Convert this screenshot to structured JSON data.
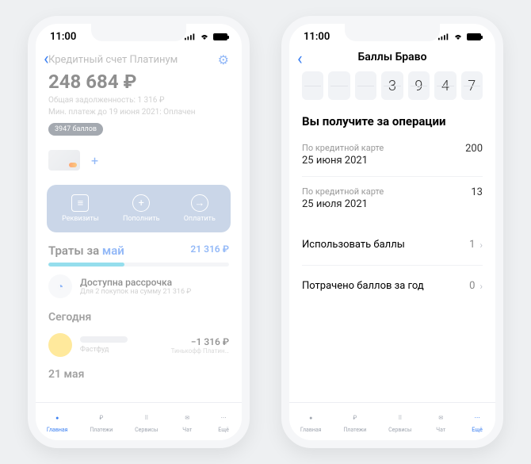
{
  "status": {
    "time": "11:00"
  },
  "left": {
    "account_title": "Кредитный счет Платинум",
    "balance": "248 684 ₽",
    "debt_line": "Общая задолженность: 1 316 ₽",
    "payment_line": "Мин. платеж до 19 июня 2021: Оплачен",
    "points_pill": "3947 баллов",
    "actions": {
      "details": "Реквизиты",
      "topup": "Пополнить",
      "pay": "Оплатить"
    },
    "spending": {
      "label": "Траты за",
      "month": "май",
      "amount": "21 316 ₽"
    },
    "installment": {
      "title": "Доступна рассрочка",
      "subtitle": "Для 2 покупок на сумму 21 316 ₽"
    },
    "today_label": "Сегодня",
    "txn": {
      "category": "Фастфуд",
      "amount": "−1 316 ₽",
      "source": "Тинькофф Платин…"
    },
    "date2": "21 мая",
    "tabs": {
      "home": "Главная",
      "payments": "Платежи",
      "services": "Сервисы",
      "chat": "Чат",
      "more": "Ещё"
    }
  },
  "right": {
    "title": "Баллы Браво",
    "digits": [
      "",
      "",
      "",
      "3",
      "9",
      "4",
      "7"
    ],
    "section_title": "Вы получите за операции",
    "ops": [
      {
        "label": "По кредитной карте",
        "date": "25 июня 2021",
        "value": "200"
      },
      {
        "label": "По кредитной карте",
        "date": "25 июля 2021",
        "value": "13"
      }
    ],
    "use_points": {
      "label": "Использовать баллы",
      "value": "1"
    },
    "spent_year": {
      "label": "Потрачено баллов за год",
      "value": "0"
    },
    "tabs": {
      "home": "Главная",
      "payments": "Платежи",
      "services": "Сервисы",
      "chat": "Чат",
      "more": "Ещё"
    }
  }
}
